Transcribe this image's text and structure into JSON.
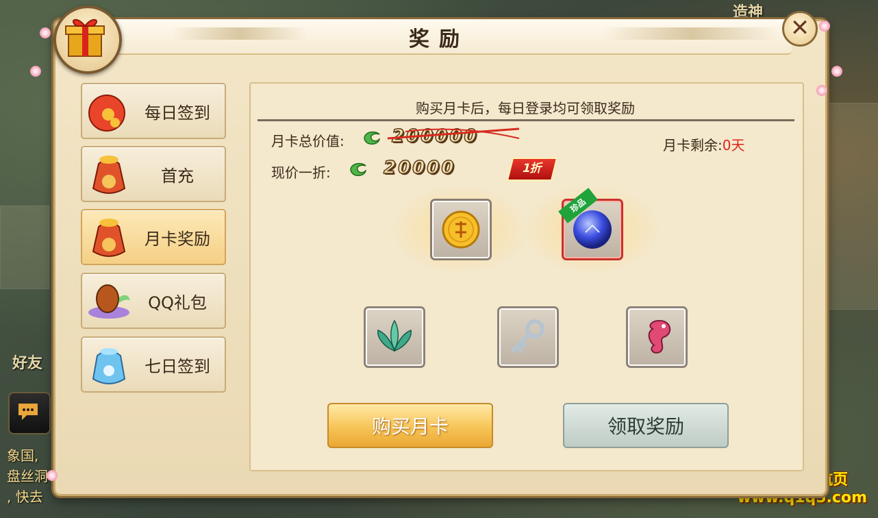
{
  "background": {
    "scene_text_1": "造神",
    "scene_text_2": "好友",
    "chat_lines": [
      "象国,",
      "盘丝洞",
      ", 快去"
    ]
  },
  "watermark": {
    "line1": "踏月导航页",
    "line2": "www.q1q5.com"
  },
  "dialog": {
    "title": "奖励",
    "close_icon": "close-x-icon",
    "header_icon": "gift-box-icon"
  },
  "sidebar": {
    "items": [
      {
        "label": "每日签到",
        "icon": "red-pouch-icon",
        "active": false
      },
      {
        "label": "首充",
        "icon": "lucky-bag-icon",
        "active": false
      },
      {
        "label": "月卡奖励",
        "icon": "lucky-bag-icon",
        "active": true
      },
      {
        "label": "QQ礼包",
        "icon": "egg-icon",
        "active": false
      },
      {
        "label": "七日签到",
        "icon": "blue-bag-icon",
        "active": false
      }
    ]
  },
  "monthly_card": {
    "notice": "购买月卡后，每日登录均可领取奖励",
    "total_value_label": "月卡总价值:",
    "total_value": "200000",
    "current_price_label": "现价一折:",
    "current_price": "20000",
    "discount_badge": "1折",
    "remaining_label": "月卡剩余:",
    "remaining_value": "0天",
    "premium_tag": "珍品",
    "rewards_top": [
      {
        "icon": "gold-coin-icon"
      },
      {
        "icon": "blue-orb-icon"
      }
    ],
    "rewards_bottom": [
      {
        "icon": "green-lotus-icon"
      },
      {
        "icon": "key-icon"
      },
      {
        "icon": "seahorse-icon"
      }
    ],
    "buy_button": "购买月卡",
    "claim_button": "领取奖励"
  },
  "colors": {
    "accent_red": "#e0261c",
    "active_tab": "#f5cf85",
    "panel_bg": "#f4e8cd"
  }
}
